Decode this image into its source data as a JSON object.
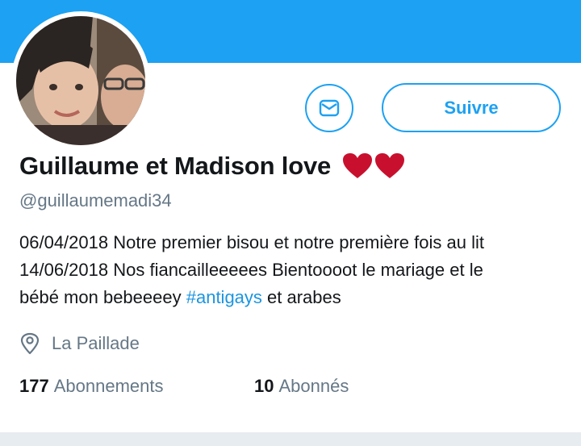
{
  "profile": {
    "display_name": "Guillaume et Madison love",
    "handle": "@guillaumemadi34",
    "bio": {
      "line1": "06/04/2018 Notre premier bisou et notre première fois au lit",
      "line2": "14/06/2018 Nos fiancailleeeees Bientoooot le mariage et le",
      "line3_before": "bébé mon bebeeeey ",
      "line3_hashtag": "#antigays",
      "line3_after": " et arabes"
    },
    "location": "La Paillade",
    "following": {
      "count": "177",
      "label": "Abonnements"
    },
    "followers": {
      "count": "10",
      "label": "Abonnés"
    }
  },
  "actions": {
    "follow_label": "Suivre"
  },
  "icons": [
    "envelope-icon",
    "heart-icon",
    "location-pin-icon"
  ],
  "colors": {
    "banner": "#1da1f2",
    "accent": "#1da1f2",
    "hashtag": "#1b95e0",
    "secondary_text": "#657786",
    "heart": "#e0245e"
  }
}
